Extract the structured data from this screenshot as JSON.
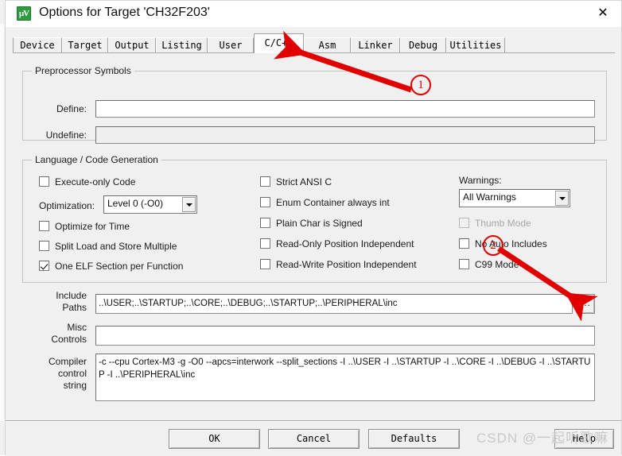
{
  "window": {
    "title": "Options for Target 'CH32F203'",
    "icon_name": "keil-uvision-icon",
    "close_label": "✕"
  },
  "tabs": [
    {
      "label": "Device",
      "selected": false
    },
    {
      "label": "Target",
      "selected": false
    },
    {
      "label": "Output",
      "selected": false
    },
    {
      "label": "Listing",
      "selected": false
    },
    {
      "label": "User",
      "selected": false
    },
    {
      "label": "C/C++",
      "selected": true
    },
    {
      "label": "Asm",
      "selected": false
    },
    {
      "label": "Linker",
      "selected": false
    },
    {
      "label": "Debug",
      "selected": false
    },
    {
      "label": "Utilities",
      "selected": false
    }
  ],
  "preprocessor": {
    "group_title": "Preprocessor Symbols",
    "define_label": "Define:",
    "define_value": "",
    "undefine_label": "Undefine:",
    "undefine_value": ""
  },
  "language": {
    "group_title": "Language / Code Generation",
    "col1": [
      {
        "label": "Execute-only Code",
        "checked": false,
        "disabled": false
      },
      {
        "label": "Optimize for Time",
        "checked": false,
        "disabled": false
      },
      {
        "label": "Split Load and Store Multiple",
        "checked": false,
        "disabled": false
      },
      {
        "label": "One ELF Section per Function",
        "checked": true,
        "disabled": false
      }
    ],
    "optimization_label": "Optimization:",
    "optimization_value": "Level 0 (-O0)",
    "col2": [
      {
        "label": "Strict ANSI C",
        "checked": false,
        "disabled": false
      },
      {
        "label": "Enum Container always int",
        "checked": false,
        "disabled": false
      },
      {
        "label": "Plain Char is Signed",
        "checked": false,
        "disabled": false
      },
      {
        "label": "Read-Only Position Independent",
        "checked": false,
        "disabled": false
      },
      {
        "label": "Read-Write Position Independent",
        "checked": false,
        "disabled": false
      }
    ],
    "warnings_label": "Warnings:",
    "warnings_value": "All Warnings",
    "col3": [
      {
        "label": "Thumb Mode",
        "checked": false,
        "disabled": true
      },
      {
        "label": "No Auto Includes",
        "checked": false,
        "disabled": false
      },
      {
        "label": "C99 Mode",
        "checked": false,
        "disabled": false
      }
    ]
  },
  "paths": {
    "include_label_line1": "Include",
    "include_label_line2": "Paths",
    "include_value": "..\\USER;..\\STARTUP;..\\CORE;..\\DEBUG;..\\STARTUP;..\\PERIPHERAL\\inc",
    "browse_label": "...",
    "misc_label_line1": "Misc",
    "misc_label_line2": "Controls",
    "misc_value": "",
    "compiler_label_line1": "Compiler",
    "compiler_label_line2": "control",
    "compiler_label_line3": "string",
    "compiler_value": "-c --cpu Cortex-M3 -g -O0 --apcs=interwork --split_sections -I ..\\USER -I ..\\STARTUP -I ..\\CORE -I ..\\DEBUG -I ..\\STARTUP -I ..\\PERIPHERAL\\inc"
  },
  "footer": {
    "ok": "OK",
    "cancel": "Cancel",
    "defaults": "Defaults",
    "help": "Help"
  },
  "watermark": {
    "text": "CSDN @一起听歌嘛"
  },
  "annotations": {
    "accent_color": "#e10000",
    "marker_one": "①",
    "marker_one_text": "1",
    "marker_two_text": "2"
  }
}
